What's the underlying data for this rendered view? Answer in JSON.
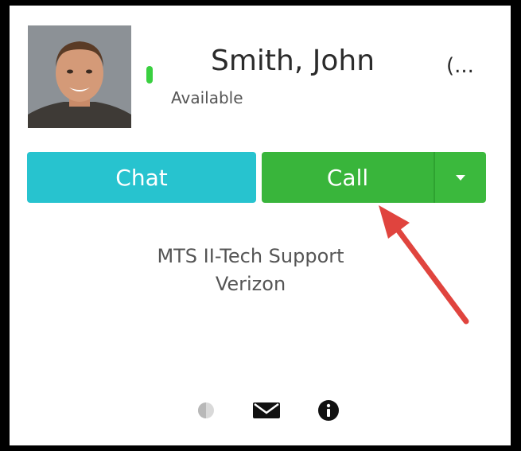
{
  "contact": {
    "name": "Smith, John",
    "name_overflow": "(...",
    "status": "Available",
    "status_color": "#3ad040",
    "title": "MTS II-Tech Support",
    "company": "Verizon"
  },
  "actions": {
    "chat_label": "Chat",
    "call_label": "Call",
    "chat_color": "#27c3cf",
    "call_color": "#39b53b"
  },
  "annotation": {
    "arrow_color": "#e0443e"
  },
  "footer_icons": [
    "presence-icon",
    "mail-icon",
    "info-icon"
  ]
}
